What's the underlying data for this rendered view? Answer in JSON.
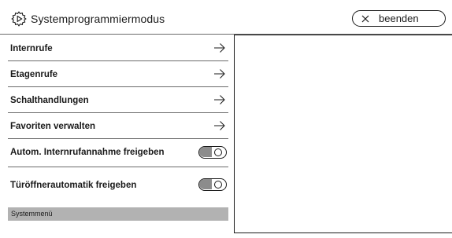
{
  "header": {
    "title": "Systemprogrammiermodus",
    "exit_label": "beenden"
  },
  "menu": {
    "items": [
      {
        "label": "Internrufe"
      },
      {
        "label": "Etagenrufe"
      },
      {
        "label": "Schalthandlungen"
      },
      {
        "label": "Favoriten verwalten"
      }
    ],
    "toggles": [
      {
        "label": "Autom. Internrufannahme freigeben",
        "state": "off"
      },
      {
        "label": "Türöffnerautomatik freigeben",
        "state": "off"
      }
    ]
  },
  "footer_bar": {
    "label": "Systemmenü"
  },
  "icons": {
    "header": "gear-icon",
    "exit": "close-icon",
    "row": "arrow-right-icon"
  },
  "colors": {
    "text": "#1a1a1a",
    "divider": "#6a6a6a",
    "bar": "#b2b2b2",
    "toggle_fill": "#8c8c8c"
  }
}
